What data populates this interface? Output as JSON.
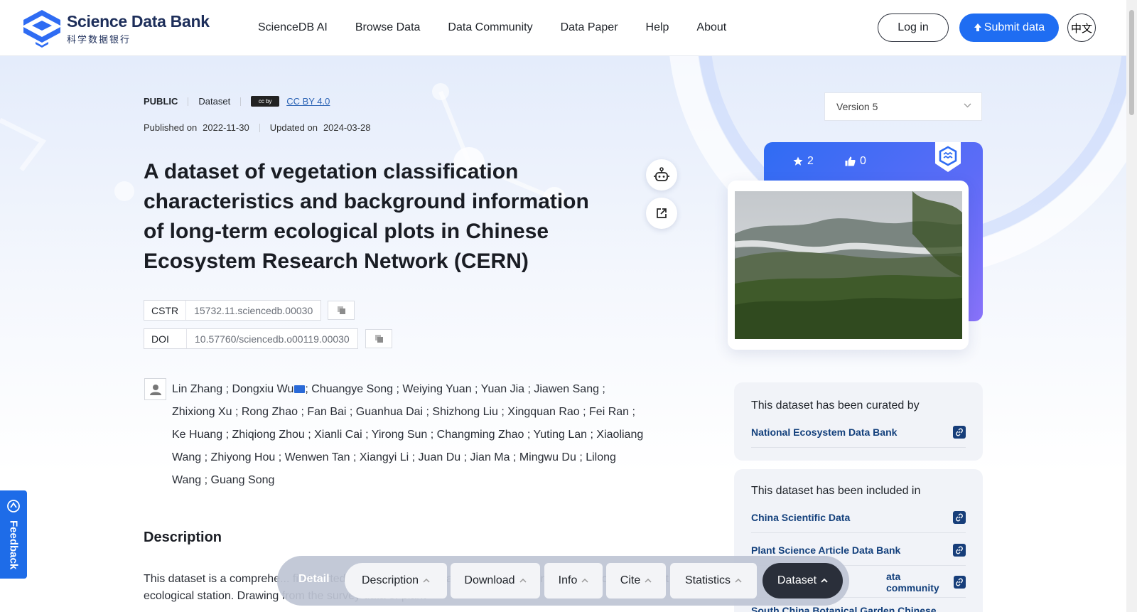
{
  "header": {
    "logo_en": "Science Data Bank",
    "logo_cn": "科学数据银行",
    "nav": [
      "ScienceDB AI",
      "Browse Data",
      "Data Community",
      "Data Paper",
      "Help",
      "About"
    ],
    "login": "Log in",
    "submit": "Submit data",
    "lang": "中文"
  },
  "meta": {
    "access": "PUBLIC",
    "type": "Dataset",
    "license_badge": "cc by",
    "license": "CC BY 4.0",
    "published_label": "Published on",
    "published": "2022-11-30",
    "updated_label": "Updated on",
    "updated": "2024-03-28"
  },
  "title": "A dataset of vegetation classification characteristics and background information of long-term ecological plots in Chinese Ecosystem Research Network (CERN)",
  "ids": {
    "cstr_label": "CSTR",
    "cstr": "15732.11.sciencedb.00030",
    "doi_label": "DOI",
    "doi": "10.57760/sciencedb.o00119.00030"
  },
  "authors": {
    "first": "Lin Zhang ; Dongxiu Wu",
    "rest": "; Chuangye Song ; Weiying Yuan ; Yuan Jia ; Jiawen Sang ; Zhixiong Xu ; Rong Zhao ; Fan Bai ; Guanhua Dai ; Shizhong Liu ; Xingquan Rao ; Fei Ran ; Ke Huang ; Zhiqiong Zhou ; Xianli Cai ; Yirong Sun ; Changming Zhao ; Yuting Lan ; Xiaoliang Wang ; Zhiyong Hou ; Wenwen Tan ; Xiangyi Li ; Juan Du ; Jian Ma ; Mingwu Du ; Lilong Wang ; Guang Song"
  },
  "description": {
    "heading": "Description",
    "text": "This dataset is a comprehe... first sorted out the backgrou... and representativeness of the long-term plot of ecological station. Drawing from the survey data of plant"
  },
  "right": {
    "version": "Version 5",
    "stars": "2",
    "likes": "0",
    "curated_title": "This dataset has been curated by",
    "curated": [
      "National Ecosystem Data Bank"
    ],
    "included_title": "This dataset has been included in",
    "included": [
      "China Scientific Data",
      "Plant Science Article Data Bank",
      "ata community",
      "South China Botanical Garden Chinese"
    ]
  },
  "feedback": "Feedback",
  "bottom_nav": {
    "detail": "Detail",
    "tabs": [
      "Description",
      "Download",
      "Info",
      "Cite",
      "Statistics",
      "Dataset"
    ]
  },
  "colors": {
    "primary": "#1f6df2",
    "link": "#13407c",
    "dark": "#2a2f3a"
  }
}
